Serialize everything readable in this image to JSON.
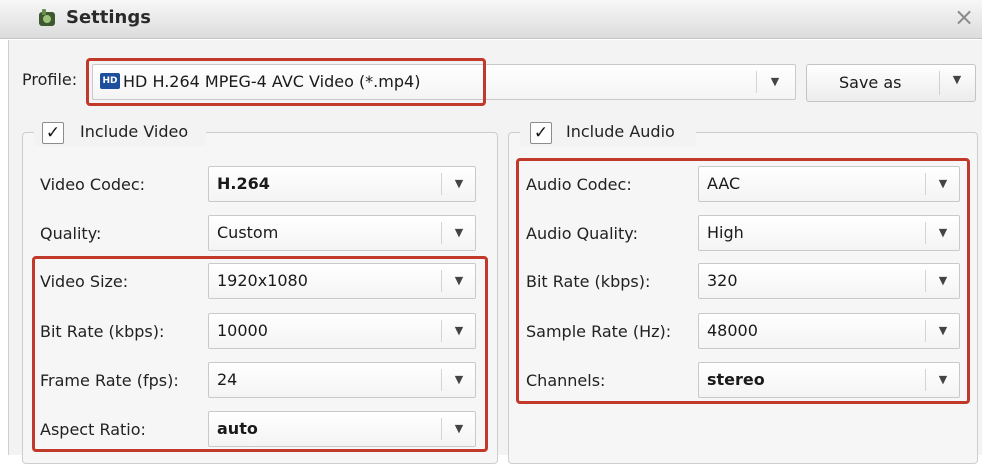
{
  "window": {
    "title": "Settings",
    "close": "×"
  },
  "profile": {
    "label": "Profile:",
    "icon_badge": "HD",
    "value": "HD H.264 MPEG-4 AVC Video (*.mp4)",
    "save_as": "Save as"
  },
  "video": {
    "include_label": "Include Video",
    "checked": true,
    "fields": [
      {
        "label": "Video Codec:",
        "value": "H.264"
      },
      {
        "label": "Quality:",
        "value": "Custom"
      },
      {
        "label": "Video Size:",
        "value": "1920x1080"
      },
      {
        "label": "Bit Rate (kbps):",
        "value": "10000"
      },
      {
        "label": "Frame Rate (fps):",
        "value": "24"
      },
      {
        "label": "Aspect Ratio:",
        "value": "auto"
      }
    ]
  },
  "audio": {
    "include_label": "Include Audio",
    "checked": true,
    "fields": [
      {
        "label": "Audio Codec:",
        "value": "AAC"
      },
      {
        "label": "Audio Quality:",
        "value": "High"
      },
      {
        "label": "Bit Rate (kbps):",
        "value": "320"
      },
      {
        "label": "Sample Rate (Hz):",
        "value": "48000"
      },
      {
        "label": "Channels:",
        "value": "stereo"
      }
    ]
  },
  "checkmark": "✓",
  "dropdown_glyph": "▼",
  "colors": {
    "highlight": "#c0392b",
    "hd_badge": "#1d4f9c"
  }
}
